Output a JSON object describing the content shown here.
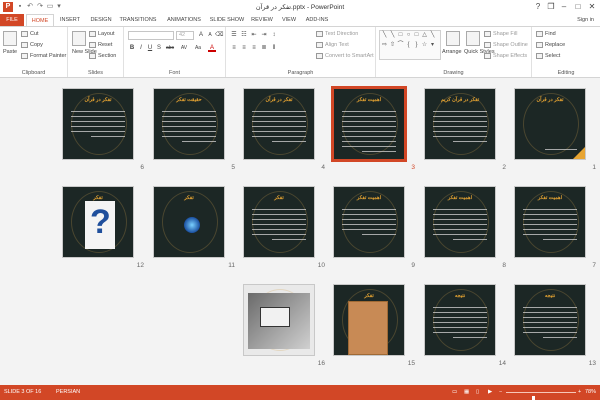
{
  "window": {
    "title": "تفکر در قرآن.pptx - PowerPoint",
    "app_icon_letter": "P",
    "controls": {
      "help": "?",
      "restore": "❐",
      "minimize": "–",
      "maximize": "□",
      "close": "✕"
    }
  },
  "tabs": [
    "FILE",
    "HOME",
    "INSERT",
    "DESIGN",
    "TRANSITIONS",
    "ANIMATIONS",
    "SLIDE SHOW",
    "REVIEW",
    "VIEW",
    "ADD-INS"
  ],
  "active_tab": "HOME",
  "signin": "Sign in",
  "ribbon": {
    "clipboard": {
      "label": "Clipboard",
      "paste": "Paste",
      "cut": "Cut",
      "copy": "Copy",
      "format_painter": "Format Painter"
    },
    "slides": {
      "label": "Slides",
      "new_slide": "New Slide",
      "layout": "Layout",
      "reset": "Reset",
      "section": "Section"
    },
    "font": {
      "label": "Font",
      "font_name": "",
      "font_size": "42",
      "bold": "B",
      "italic": "I",
      "underline": "U",
      "shadow": "S",
      "strike": "abc",
      "spacing": "AV",
      "case": "Aa",
      "color": "A"
    },
    "paragraph": {
      "label": "Paragraph",
      "text_direction": "Text Direction",
      "align_text": "Align Text",
      "smartart": "Convert to SmartArt"
    },
    "drawing": {
      "label": "Drawing",
      "arrange": "Arrange",
      "quick_styles": "Quick Styles",
      "shape_fill": "Shape Fill",
      "shape_outline": "Shape Outline",
      "shape_effects": "Shape Effects"
    },
    "editing": {
      "label": "Editing",
      "find": "Find",
      "replace": "Replace",
      "select": "Select"
    }
  },
  "slides": [
    {
      "num": "1",
      "title": "تفکر در قرآن"
    },
    {
      "num": "2",
      "title": "تفکر در قرآن کریم"
    },
    {
      "num": "3",
      "title": "اهمیت تفکر"
    },
    {
      "num": "4",
      "title": "تفکر در قرآن"
    },
    {
      "num": "5",
      "title": "حقیقت تفکر"
    },
    {
      "num": "6",
      "title": "تفکر در قرآن"
    },
    {
      "num": "7",
      "title": "اهمیت تفکر"
    },
    {
      "num": "8",
      "title": "اهمیت تفکر"
    },
    {
      "num": "9",
      "title": "اهمیت تفکر"
    },
    {
      "num": "10",
      "title": "تفکر"
    },
    {
      "num": "11",
      "title": "تفکر"
    },
    {
      "num": "12",
      "title": "تفکر"
    },
    {
      "num": "13",
      "title": "نتیجه"
    },
    {
      "num": "14",
      "title": "نتیجه"
    },
    {
      "num": "15",
      "title": "تفکر"
    },
    {
      "num": "16",
      "title": ""
    }
  ],
  "selected_slide": "3",
  "status": {
    "slide_info": "SLIDE 3 OF 16",
    "language": "PERSIAN",
    "zoom": "78%",
    "zoom_level_percent": 78
  },
  "colors": {
    "accent": "#d24726",
    "slide_bg": "#1c2725",
    "slide_title": "#e8a532"
  }
}
